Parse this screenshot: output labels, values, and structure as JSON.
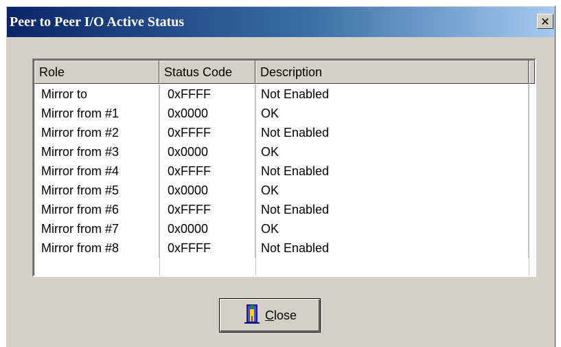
{
  "window": {
    "title": "Peer to Peer I/O Active Status",
    "close_glyph": "✕"
  },
  "list": {
    "columns": [
      "Role",
      "Status Code",
      "Description"
    ],
    "rows": [
      {
        "role": "Mirror to",
        "code": "0xFFFF",
        "desc": "Not Enabled"
      },
      {
        "role": "Mirror from #1",
        "code": "0x0000",
        "desc": "OK"
      },
      {
        "role": "Mirror from #2",
        "code": "0xFFFF",
        "desc": "Not Enabled"
      },
      {
        "role": "Mirror from #3",
        "code": "0x0000",
        "desc": "OK"
      },
      {
        "role": "Mirror from #4",
        "code": "0xFFFF",
        "desc": "Not Enabled"
      },
      {
        "role": "Mirror from #5",
        "code": "0x0000",
        "desc": "OK"
      },
      {
        "role": "Mirror from #6",
        "code": "0xFFFF",
        "desc": "Not Enabled"
      },
      {
        "role": "Mirror from #7",
        "code": "0x0000",
        "desc": "OK"
      },
      {
        "role": "Mirror from #8",
        "code": "0xFFFF",
        "desc": "Not Enabled"
      }
    ]
  },
  "button": {
    "close_mnemonic": "C",
    "close_rest": "lose",
    "icon": "door-exit-icon"
  },
  "colors": {
    "title_start": "#0a246a",
    "title_end": "#a6caf0",
    "face": "#d4d0c8"
  }
}
